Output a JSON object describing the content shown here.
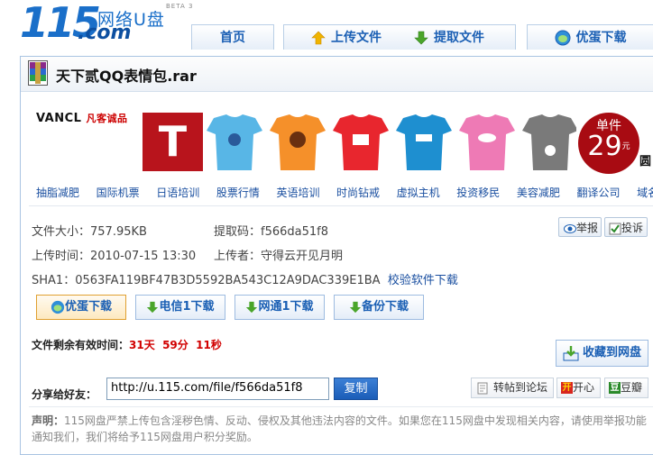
{
  "header": {
    "logo_number": "115",
    "logo_cn": "网络U盘",
    "logo_beta": "BETA 3",
    "logo_domain": ".com",
    "nav": [
      {
        "label": "首页",
        "icon": ""
      },
      {
        "label": "上传文件",
        "icon": "upload-arrow-icon"
      },
      {
        "label": "提取文件",
        "icon": "download-arrow-icon"
      },
      {
        "label": "优蛋下载",
        "icon": "youdan-icon"
      }
    ]
  },
  "file": {
    "title": "天下贰QQ表情包.rar",
    "size_label": "文件大小：",
    "size": "757.95KB",
    "code_label": "提取码：",
    "code": "f566da51f8",
    "upload_time_label": "上传时间：",
    "upload_time": "2010-07-15 13:30",
    "uploader_label": "上传者：",
    "uploader": "守得云开见月明",
    "sha1_label": "SHA1：",
    "sha1": "0563FA119BF47B3D5592BA543C12A9DAC339E1BA",
    "verify_link": "校验软件下载"
  },
  "ad": {
    "brand": "VANCL",
    "brand_cn": "凡客诚品",
    "t_letter": "T",
    "price_top": "单件",
    "price_value": "29",
    "price_unit": "元",
    "price_suffix": "圆",
    "links": [
      "抽脂减肥",
      "国际机票",
      "日语培训",
      "股票行情",
      "英语培训",
      "时尚钻戒",
      "虚拟主机",
      "投资移民",
      "美容减肥",
      "翻译公司",
      "域名"
    ]
  },
  "actions": {
    "report": "举报",
    "complain": "投诉",
    "download_buttons": [
      "优蛋下载",
      "电信1下载",
      "网通1下载",
      "备份下载"
    ],
    "save_to_disk": "收藏到网盘"
  },
  "timer": {
    "label": "文件剩余有效时间：",
    "days": "31天",
    "minutes": "59分",
    "seconds": "11秒"
  },
  "share": {
    "label": "分享给好友：",
    "url": "http://u.115.com/file/f566da51f8",
    "copy": "复制",
    "forum": "转帖到论坛",
    "kaixin": "开心",
    "douban": "豆瓣"
  },
  "notice": {
    "label": "声明：",
    "text": "115网盘严禁上传包含淫秽色情、反动、侵权及其他违法内容的文件。如果您在115网盘中发现相关内容，请使用举报功能通知我们，我们将给予115网盘用户积分奖励。"
  },
  "colors": {
    "brand_blue": "#1a6fc9",
    "red": "#d10000",
    "price_red": "#a80b12"
  }
}
